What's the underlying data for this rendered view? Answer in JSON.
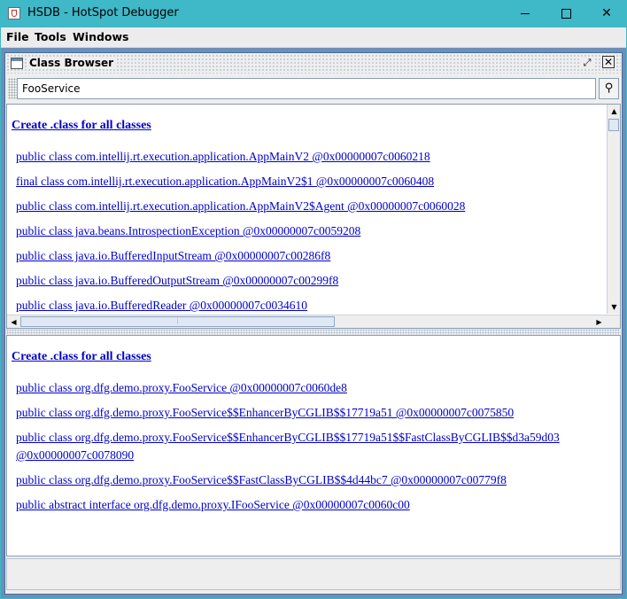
{
  "window": {
    "title": "HSDB - HotSpot Debugger",
    "controls": {
      "minimize": "minimize-icon",
      "maximize": "maximize-icon",
      "close": "✕"
    }
  },
  "menubar": {
    "items": [
      "File",
      "Tools",
      "Windows"
    ]
  },
  "class_browser": {
    "title": "Class Browser",
    "search": {
      "value": "FooService",
      "find_icon": "binoculars-icon"
    },
    "top_pane": {
      "header_link": "Create .class for all classes",
      "classes": [
        "public class com.intellij.rt.execution.application.AppMainV2 @0x00000007c0060218",
        "final class com.intellij.rt.execution.application.AppMainV2$1 @0x00000007c0060408",
        "public class com.intellij.rt.execution.application.AppMainV2$Agent @0x00000007c0060028",
        "public class java.beans.IntrospectionException @0x00000007c0059208",
        "public class java.io.BufferedInputStream @0x00000007c00286f8",
        "public class java.io.BufferedOutputStream @0x00000007c00299f8",
        "public class java.io.BufferedReader @0x00000007c0034610"
      ]
    },
    "bottom_pane": {
      "header_link": "Create .class for all classes",
      "classes": [
        "public class org.dfg.demo.proxy.FooService @0x00000007c0060de8",
        "public class org.dfg.demo.proxy.FooService$$EnhancerByCGLIB$$17719a51 @0x00000007c0075850",
        "public class org.dfg.demo.proxy.FooService$$EnhancerByCGLIB$$17719a51$$FastClassByCGLIB$$d3a59d03 @0x00000007c0078090",
        "public class org.dfg.demo.proxy.FooService$$FastClassByCGLIB$$4d44bc7 @0x00000007c00779f8",
        "public abstract interface org.dfg.demo.proxy.IFooService @0x00000007c0060c00"
      ]
    }
  }
}
